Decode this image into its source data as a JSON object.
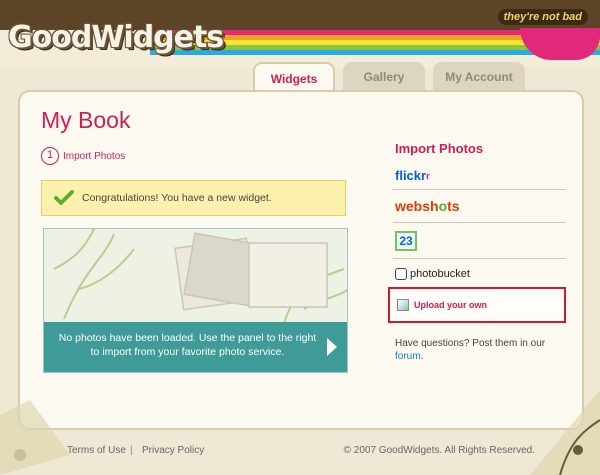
{
  "header": {
    "logo": "GoodWidgets",
    "tagline": "they're not bad"
  },
  "tabs": [
    {
      "label": "Widgets",
      "active": true
    },
    {
      "label": "Gallery",
      "active": false
    },
    {
      "label": "My Account",
      "active": false
    }
  ],
  "main": {
    "title": "My Book",
    "step": {
      "number": "1",
      "label": "Import Photos"
    },
    "notice": "Congratulations! You have a new widget.",
    "empty_message": "No photos have been loaded. Use the panel to the right to import from your favorite photo service."
  },
  "sidebar": {
    "title": "Import Photos",
    "services": {
      "flickr": {
        "main": "flickr",
        "mark": "r"
      },
      "webshots": {
        "a": "websh",
        "b": "o",
        "c": "ts"
      },
      "s23": "23",
      "photobucket": "photobucket"
    },
    "upload_label": "Upload your own",
    "questions_text": "Have questions? Post them in our",
    "forum_link": "forum",
    "period": "."
  },
  "footer": {
    "terms": "Terms of Use",
    "separator": "|",
    "privacy": "Privacy Policy",
    "copyright": "© 2007 GoodWidgets. All Rights Reserved."
  },
  "colors": {
    "accent": "#cc1f56",
    "notice_bg": "#fcf1ac",
    "teal": "#3f9b98",
    "highlight_border": "#d4182e"
  }
}
